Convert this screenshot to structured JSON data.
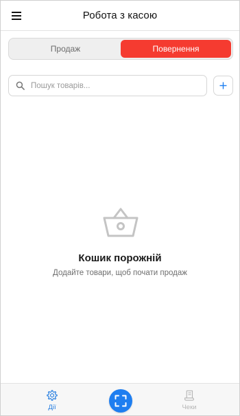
{
  "header": {
    "title": "Робота з касою",
    "menu_icon": "hamburger-menu-icon"
  },
  "mode_tabs": {
    "items": [
      {
        "label": "Продаж",
        "active": false
      },
      {
        "label": "Повернення",
        "active": true
      }
    ]
  },
  "search": {
    "placeholder": "Пошук товарів...",
    "value": "",
    "icon": "search-icon"
  },
  "add_button": {
    "icon": "plus-icon"
  },
  "empty_state": {
    "icon": "basket-icon",
    "title": "Кошик порожній",
    "subtitle": "Додайте товари, щоб почати продаж"
  },
  "bottom_nav": {
    "actions": {
      "label": "Дії",
      "icon": "gear-icon",
      "active": true
    },
    "scan": {
      "icon": "scan-icon"
    },
    "receipts": {
      "label": "Чеки",
      "icon": "receipt-icon",
      "active": false
    }
  },
  "colors": {
    "accent_red": "#f53b30",
    "accent_blue": "#1e7ef0",
    "nav_active": "#1f7ae0",
    "nav_inactive": "#b5b5b5"
  }
}
